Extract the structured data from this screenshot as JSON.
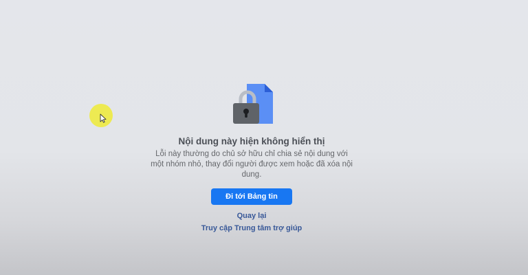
{
  "notice": {
    "icon": "locked-document-icon",
    "title": "Nội dung này hiện không hiển thị",
    "description": "Lỗi này thường do chủ sở hữu chỉ chia sẻ nội dung với một nhóm nhỏ, thay đổi người được xem hoặc đã xóa nội dung.",
    "primary_button": "Đi tới Bảng tin",
    "back_link": "Quay lại",
    "help_link": "Truy cập Trung tâm trợ giúp"
  },
  "colors": {
    "accent": "#1877f2",
    "link": "#385898",
    "title": "#4b4f56",
    "text": "#65676b",
    "cursor_highlight": "#f0ec28"
  }
}
